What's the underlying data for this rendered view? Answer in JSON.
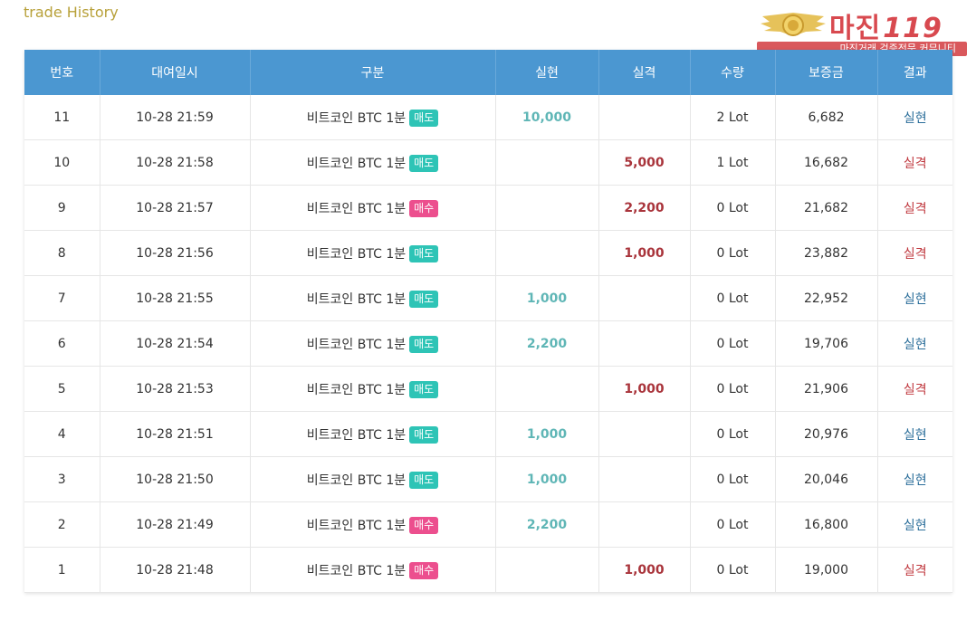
{
  "page": {
    "title": "trade History"
  },
  "logo": {
    "main_text": "마진",
    "number_text": "119",
    "banner_text": "마진거래 검증전문 커뮤니티"
  },
  "colors": {
    "header_bg": "#4b97d1",
    "sell_badge": "#2ec4b6",
    "buy_badge": "#ec4f8e",
    "profit_text": "#5fb6b6",
    "loss_text": "#a9343b",
    "title_text": "#b8a13a"
  },
  "table": {
    "headers": {
      "no": "번호",
      "datetime": "대여일시",
      "category": "구분",
      "realized": "실현",
      "lost": "실격",
      "quantity": "수량",
      "margin": "보증금",
      "result": "결과"
    },
    "rows": [
      {
        "no": "11",
        "datetime": "10-28 21:59",
        "category": "비트코인 BTC 1분",
        "side": "매도",
        "side_type": "sell",
        "realized": "10,000",
        "lost": "",
        "quantity": "2 Lot",
        "margin": "6,682",
        "result": "실현",
        "result_type": "profit"
      },
      {
        "no": "10",
        "datetime": "10-28 21:58",
        "category": "비트코인 BTC 1분",
        "side": "매도",
        "side_type": "sell",
        "realized": "",
        "lost": "5,000",
        "quantity": "1 Lot",
        "margin": "16,682",
        "result": "실격",
        "result_type": "loss"
      },
      {
        "no": "9",
        "datetime": "10-28 21:57",
        "category": "비트코인 BTC 1분",
        "side": "매수",
        "side_type": "buy",
        "realized": "",
        "lost": "2,200",
        "quantity": "0 Lot",
        "margin": "21,682",
        "result": "실격",
        "result_type": "loss"
      },
      {
        "no": "8",
        "datetime": "10-28 21:56",
        "category": "비트코인 BTC 1분",
        "side": "매도",
        "side_type": "sell",
        "realized": "",
        "lost": "1,000",
        "quantity": "0 Lot",
        "margin": "23,882",
        "result": "실격",
        "result_type": "loss"
      },
      {
        "no": "7",
        "datetime": "10-28 21:55",
        "category": "비트코인 BTC 1분",
        "side": "매도",
        "side_type": "sell",
        "realized": "1,000",
        "lost": "",
        "quantity": "0 Lot",
        "margin": "22,952",
        "result": "실현",
        "result_type": "profit"
      },
      {
        "no": "6",
        "datetime": "10-28 21:54",
        "category": "비트코인 BTC 1분",
        "side": "매도",
        "side_type": "sell",
        "realized": "2,200",
        "lost": "",
        "quantity": "0 Lot",
        "margin": "19,706",
        "result": "실현",
        "result_type": "profit"
      },
      {
        "no": "5",
        "datetime": "10-28 21:53",
        "category": "비트코인 BTC 1분",
        "side": "매도",
        "side_type": "sell",
        "realized": "",
        "lost": "1,000",
        "quantity": "0 Lot",
        "margin": "21,906",
        "result": "실격",
        "result_type": "loss"
      },
      {
        "no": "4",
        "datetime": "10-28 21:51",
        "category": "비트코인 BTC 1분",
        "side": "매도",
        "side_type": "sell",
        "realized": "1,000",
        "lost": "",
        "quantity": "0 Lot",
        "margin": "20,976",
        "result": "실현",
        "result_type": "profit"
      },
      {
        "no": "3",
        "datetime": "10-28 21:50",
        "category": "비트코인 BTC 1분",
        "side": "매도",
        "side_type": "sell",
        "realized": "1,000",
        "lost": "",
        "quantity": "0 Lot",
        "margin": "20,046",
        "result": "실현",
        "result_type": "profit"
      },
      {
        "no": "2",
        "datetime": "10-28 21:49",
        "category": "비트코인 BTC 1분",
        "side": "매수",
        "side_type": "buy",
        "realized": "2,200",
        "lost": "",
        "quantity": "0 Lot",
        "margin": "16,800",
        "result": "실현",
        "result_type": "profit"
      },
      {
        "no": "1",
        "datetime": "10-28 21:48",
        "category": "비트코인 BTC 1분",
        "side": "매수",
        "side_type": "buy",
        "realized": "",
        "lost": "1,000",
        "quantity": "0 Lot",
        "margin": "19,000",
        "result": "실격",
        "result_type": "loss"
      }
    ]
  }
}
